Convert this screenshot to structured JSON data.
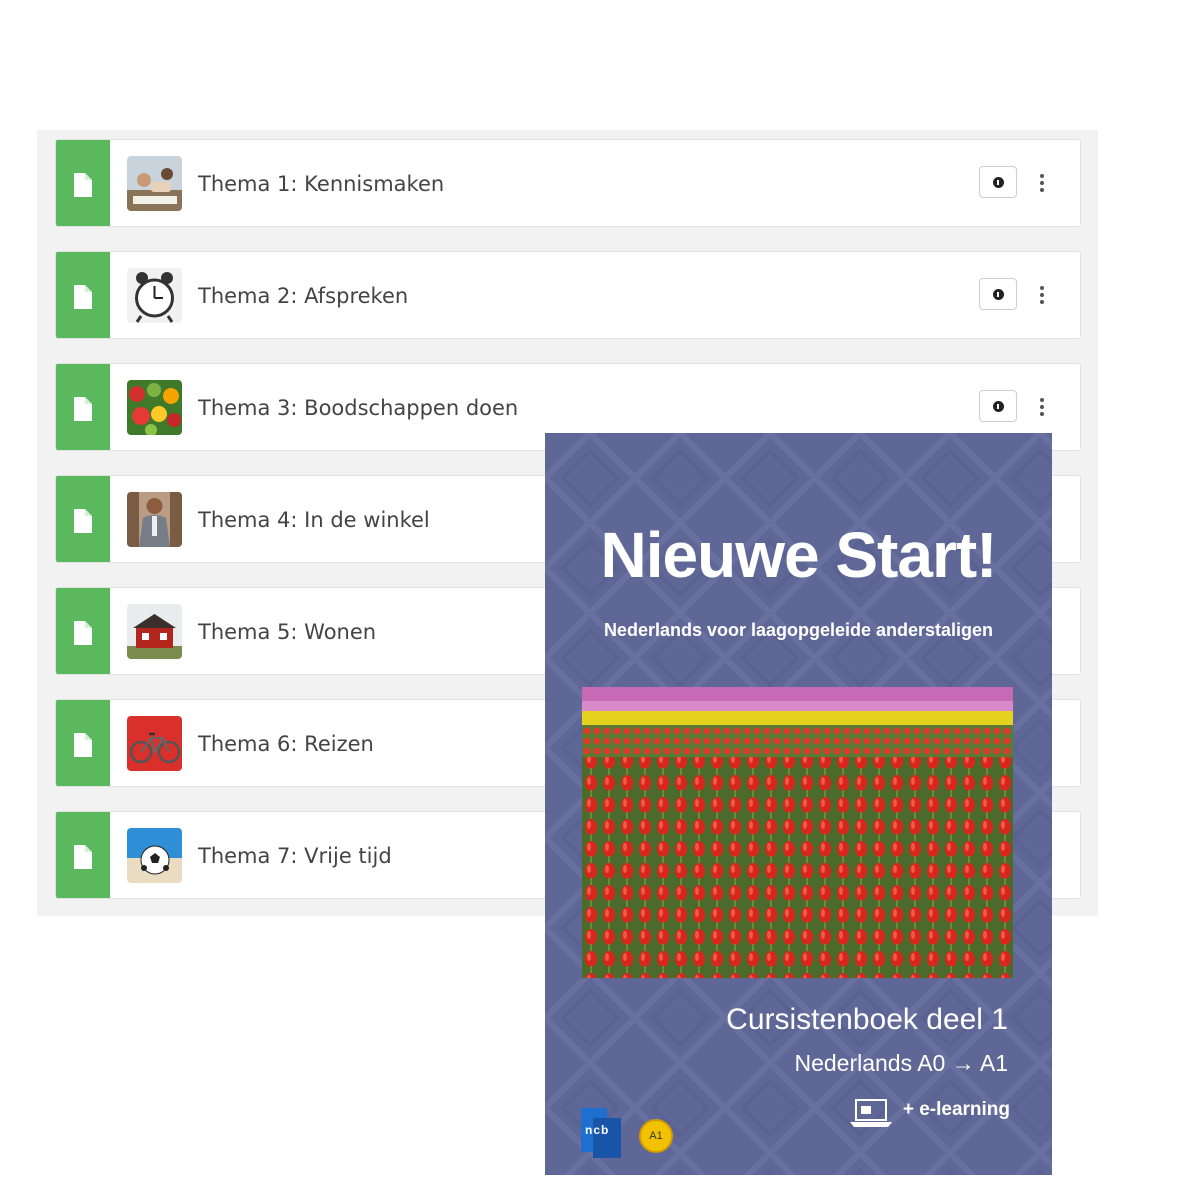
{
  "course": {
    "items": [
      {
        "title": "Thema 1: Kennismaken",
        "thumb": "meeting-photo-icon",
        "info_icon": "info-icon",
        "has_actions": true
      },
      {
        "title": "Thema 2: Afspreken",
        "thumb": "alarm-clock-photo-icon",
        "info_icon": "info-icon",
        "has_actions": true
      },
      {
        "title": "Thema 3: Boodschappen doen",
        "thumb": "vegetables-photo-icon",
        "info_icon": "info-icon",
        "has_actions": true
      },
      {
        "title": "Thema 4: In de winkel",
        "thumb": "shop-assistant-photo-icon",
        "has_actions": false
      },
      {
        "title": "Thema 5: Wonen",
        "thumb": "house-photo-icon",
        "has_actions": false
      },
      {
        "title": "Thema 6: Reizen",
        "thumb": "bicycle-photo-icon",
        "has_actions": false
      },
      {
        "title": "Thema 7: Vrije tijd",
        "thumb": "football-photo-icon",
        "has_actions": false
      }
    ],
    "stripe_color": "#5cb85c",
    "file_icon": "file-icon"
  },
  "book": {
    "title": "Nieuwe Start!",
    "subtitle": "Nederlands voor laagopgeleide anderstaligen",
    "level_title": "Cursistenboek deel 1",
    "level_range": "Nederlands A0 → A1",
    "elearning": "+ e-learning",
    "publisher_logo_text": "ncb",
    "badge": "A1",
    "cover_color": "#5f6797",
    "photo": "tulip-field-photo"
  }
}
